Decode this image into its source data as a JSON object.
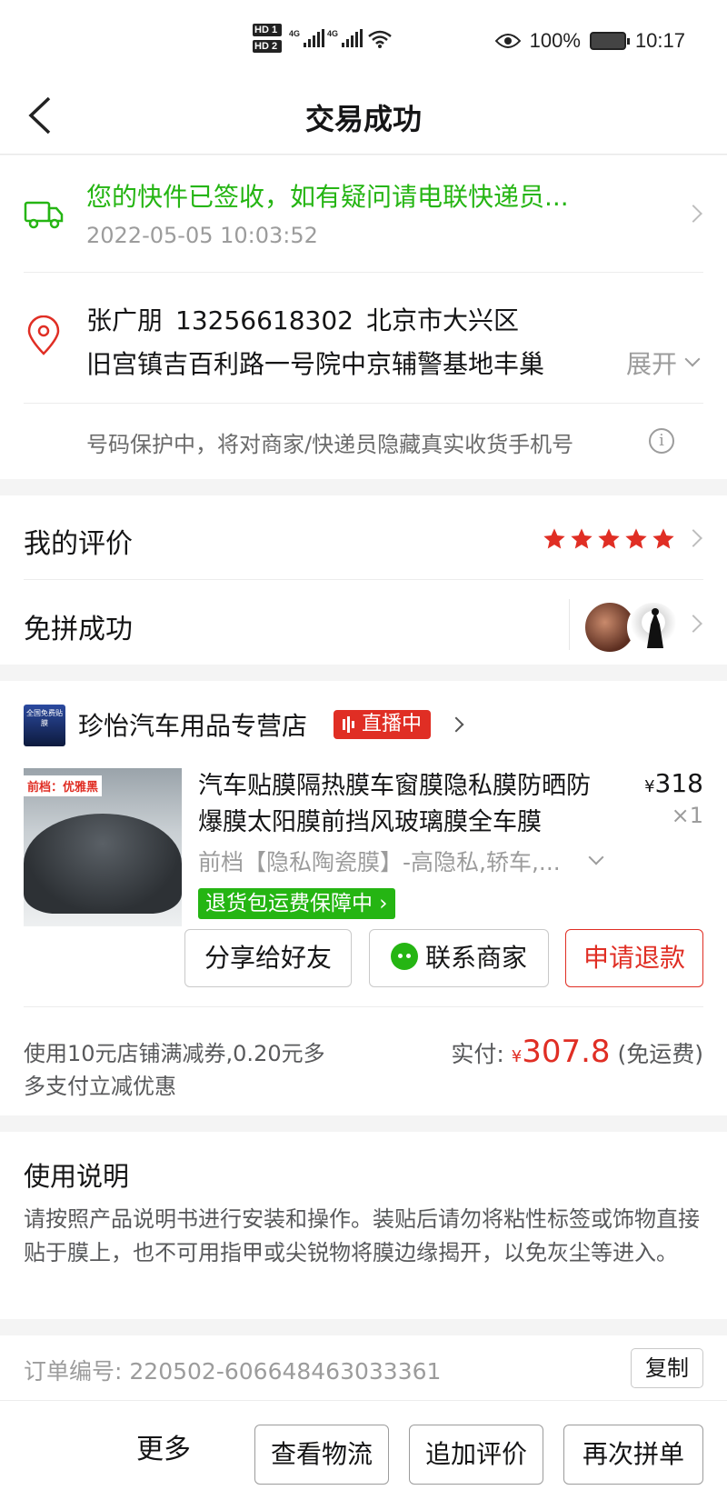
{
  "status_bar": {
    "hd1": "HD 1",
    "hd2": "HD 2",
    "net1": "4G",
    "net2": "4G",
    "battery": "100%",
    "time": "10:17"
  },
  "nav": {
    "title": "交易成功"
  },
  "logistics": {
    "message": "您的快件已签收，如有疑问请电联快递员...",
    "time": "2022-05-05 10:03:52"
  },
  "address": {
    "name": "张广朋",
    "phone": "13256618302",
    "region": "北京市大兴区",
    "detail": "旧宫镇吉百利路一号院中京辅警基地丰巢",
    "expand_label": "展开",
    "privacy_note": "号码保护中，将对商家/快递员隐藏真实收货手机号"
  },
  "review": {
    "label": "我的评价",
    "rating": 5
  },
  "group": {
    "label": "免拼成功"
  },
  "order": {
    "store_name": "珍怡汽车用品专营店",
    "store_logo_text": "全国免费贴膜",
    "live_label": "直播中",
    "product": {
      "image_tag": "前档：优雅黑",
      "title": "汽车贴膜隔热膜车窗膜隐私膜防晒防爆膜太阳膜前挡风玻璃膜全车膜",
      "currency": "¥",
      "price": "318",
      "qty": "×1",
      "spec": "前档【隐私陶瓷膜】-高隐私,轿车,...",
      "guarantee": "退货包运费保障中"
    },
    "buttons": {
      "share": "分享给好友",
      "contact": "联系商家",
      "refund": "申请退款"
    },
    "coupon_note": "使用10元店铺满减券,0.20元多多支付立减优惠",
    "paid_label": "实付:",
    "paid_currency": "¥",
    "paid_amount": "307.8",
    "paid_note": "(免运费)"
  },
  "usage": {
    "title": "使用说明",
    "text": "请按照产品说明书进行安装和操作。装贴后请勿将粘性标签或饰物直接贴于膜上，也不可用指甲或尖锐物将膜边缘揭开，以免灰尘等进入。"
  },
  "order_info": {
    "order_no_label": "订单编号:",
    "order_no": "220502-606648463033361",
    "copy_label": "复制"
  },
  "bottom": {
    "more": "更多",
    "logistics": "查看物流",
    "add_review": "追加评价",
    "regroup": "再次拼单"
  },
  "colors": {
    "accent_red": "#e02e24",
    "accent_green": "#25b513"
  }
}
